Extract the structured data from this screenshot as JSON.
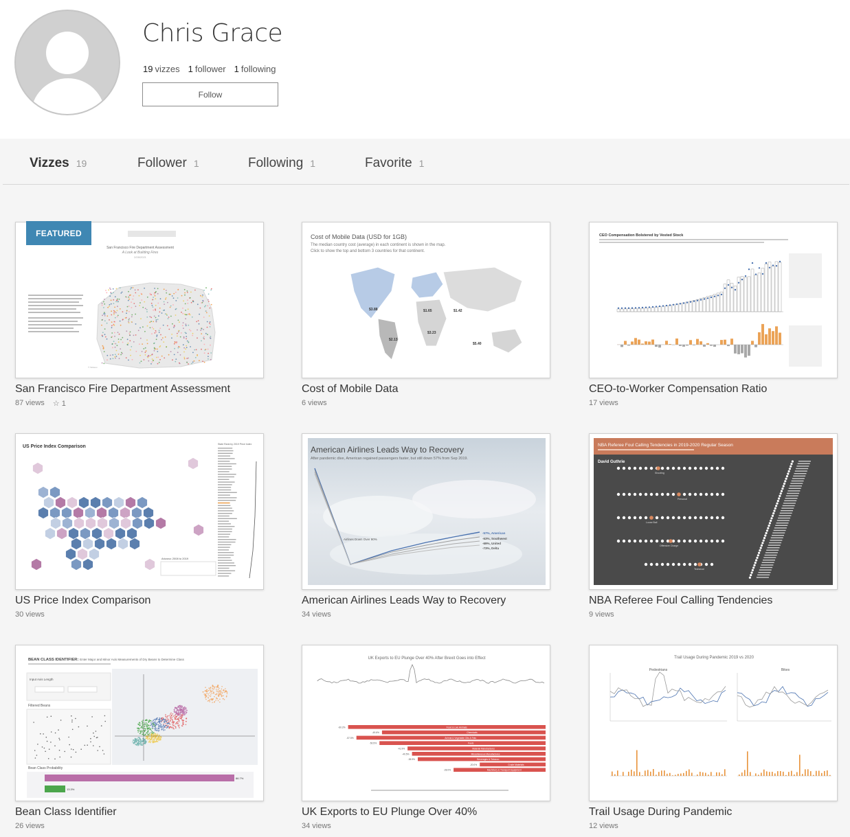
{
  "profile": {
    "name": "Chris Grace",
    "vizzes_count": "19",
    "vizzes_label": "vizzes",
    "follower_count": "1",
    "follower_label": "follower",
    "following_count": "1",
    "following_label": "following",
    "follow_button": "Follow",
    "avatar_icon": "user-avatar-placeholder"
  },
  "tabs": [
    {
      "label": "Vizzes",
      "count": "19",
      "active": true
    },
    {
      "label": "Follower",
      "count": "1",
      "active": false
    },
    {
      "label": "Following",
      "count": "1",
      "active": false
    },
    {
      "label": "Favorite",
      "count": "1",
      "active": false
    }
  ],
  "featured_badge": "FEATURED",
  "colors": {
    "featured": "#3f87b3",
    "orange": "#e8933a",
    "blue": "#5a7db5",
    "red": "#d9534f",
    "purple": "#b96ea8"
  },
  "cards": [
    {
      "title": "San Francisco Fire Department Assessment",
      "views": "87 views",
      "favorites": "1",
      "thumb": {
        "title": "San Francisco Fire Department Assessment",
        "subtitle": "A Look at Building Fires",
        "date": "2/28/2021"
      }
    },
    {
      "title": "Cost of Mobile Data",
      "views": "6 views",
      "thumb": {
        "title": "Cost of Mobile Data (USD for 1GB)",
        "line1": "The median country cost (average) in each continent is shown in the map.",
        "line2": "Click to show the top and bottom 3 countries for that continent.",
        "labels": [
          "$3.88",
          "$1.65",
          "$1.42",
          "$2.13",
          "$3.23",
          "$5.40"
        ]
      }
    },
    {
      "title": "CEO-to-Worker Compensation Ratio",
      "views": "17 views",
      "thumb": {
        "title": "CEO Compensation Bolstered by Vested Stock"
      }
    },
    {
      "title": "US Price Index Comparison",
      "views": "30 views",
      "thumb": {
        "title": "US Price Index Comparison",
        "legend_title": "State Rank by 2019 Price Index",
        "note": "Arizona: 2008 to 2019"
      }
    },
    {
      "title": "American Airlines Leads Way to Recovery",
      "views": "34 views",
      "thumb": {
        "title": "American Airlines Leads Way to Recovery",
        "subtitle": "After pandemic dive, American regained passengers faster, but still down 57% from Sep 2019.",
        "annotation": "Airlines Down Over 90%",
        "labels": [
          "-57%, American",
          "-63%, Southwest",
          "-69%, United",
          "-73%, Delta"
        ]
      }
    },
    {
      "title": "NBA Referee Foul Calling Tendencies",
      "views": "9 views",
      "thumb": {
        "title": "NBA Referee Foul Calling Tendencies in 2019-2020 Regular Season",
        "referee": "David Guthrie",
        "categories": [
          "Shooting",
          "Personal",
          "Loose Ball",
          "Offensive Charge",
          "Technical"
        ]
      }
    },
    {
      "title": "Bean Class Identifier",
      "views": "26 views",
      "thumb": {
        "title": "BEAN CLASS IDENTIFIER:",
        "title_rest": "Enter Major and Minor Axis Measurements of Dry Beans to Determine Class",
        "input_label": "Input Axis Length",
        "filtered_label": "Filtered Beans",
        "prob_label": "Bean Class Probability",
        "prob_values": [
          "86.7%",
          "13.3%"
        ]
      }
    },
    {
      "title": "UK Exports to EU Plunge Over 40%",
      "views": "34 views",
      "thumb": {
        "title": "UK Exports to EU Plunge Over 40% After Brexit Goes into Effect",
        "bars": [
          "Food & Live Animals",
          "Chemicals",
          "Animal & Vegetable Oils & Fats",
          "Fuels",
          "Material Manufactures",
          "Miscellaneous Manufactures",
          "Beverages & Tobacco",
          "Crude Materials",
          "Machinery & Transport Equipment"
        ],
        "values": [
          "-60.2%",
          "-49.6%",
          "-57.5%",
          "-50.5%",
          "-41.9%",
          "-40.5%",
          "-38.9%",
          "-20.0%",
          "-28.0%"
        ]
      }
    },
    {
      "title": "Trail Usage During Pandemic",
      "views": "12 views",
      "thumb": {
        "title": "Trail Usage During Pandemic 2019 vs 2020",
        "left": "Pedestrians",
        "right": "Bikes"
      }
    }
  ]
}
